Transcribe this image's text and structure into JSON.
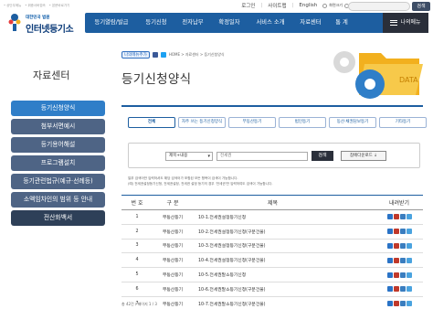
{
  "utility": {
    "left_links": [
      "• 상단우메뉴",
      "• 위종서버접속",
      "• 본문바로가기"
    ],
    "login": "로그인",
    "sitemap": "사이트맵",
    "english": "English",
    "zoom_label": "화면크기",
    "search_button": "검색"
  },
  "logo": {
    "sub": "대한민국 법원",
    "main": "인터넷등기소"
  },
  "nav": {
    "items": [
      "등기열람/발급",
      "등기신청",
      "전자납부",
      "확정일자",
      "서비스 소개",
      "자료센터",
      "통 계"
    ],
    "menu": "나의메뉴"
  },
  "sidebar": {
    "title": "자료센터",
    "items": [
      "등기신청양식",
      "첨부서면예시",
      "등기용어해설",
      "프로그램설치",
      "등기관련법규(예규·선례등)",
      "소액임차인의 범위 등 안내",
      "전산화백서"
    ]
  },
  "breadcrumb": {
    "badge": "나의메뉴추가",
    "path": "HOME > 자료센터 > 등기신청양식"
  },
  "page": {
    "title": "등기신청양식"
  },
  "illustration": {
    "label": "DATA"
  },
  "tabs": [
    "전체",
    "자주 쓰는 등기신청양식",
    "부동산등기",
    "법인등기",
    "동산·채권담보등기",
    "기타등기"
  ],
  "search": {
    "select_value": "제목+내용",
    "keyword": "전세권",
    "search_button": "검색",
    "download_button": "참에다운로드 ↓"
  },
  "note": {
    "line1": "일부 검색어만 입력하셔도 해당 검색어가 포함된 모든 항목이 검색이 가능합니다.",
    "line2": "(예) 전세권설정등기신청, 전세권설정, 전세권 설정 등기의 경우 '전세권'만 입력하여도 검색이 가능합니다."
  },
  "table": {
    "headers": [
      "번 호",
      "구 분",
      "제목",
      "내려받기"
    ],
    "rows": [
      {
        "no": "1",
        "type": "부동산등기",
        "title": "10-1.전세권설정등기신청"
      },
      {
        "no": "2",
        "type": "부동산등기",
        "title": "10-2.전세권설정등기신청(구분건물)"
      },
      {
        "no": "3",
        "type": "부동산등기",
        "title": "10-3.전세권설정등기신청(구분건물)"
      },
      {
        "no": "4",
        "type": "부동산등기",
        "title": "10-4.전세권설정등기신청(구분건물)"
      },
      {
        "no": "5",
        "type": "부동산등기",
        "title": "10-5.전세권말소등기신청"
      },
      {
        "no": "6",
        "type": "부동산등기",
        "title": "10-6.전세권말소등기신청(구분건물)"
      },
      {
        "no": "7",
        "type": "부동산등기",
        "title": "10-7.전세권말소등기신청(구분건물)"
      }
    ]
  },
  "pager": {
    "text": "총 42건 / 페이지 1 / 3"
  },
  "colors": {
    "nav_blue": "#1d5ea0",
    "side_active": "#2f7ec8",
    "side_item": "#4e6485",
    "dark": "#2a2f3a"
  }
}
